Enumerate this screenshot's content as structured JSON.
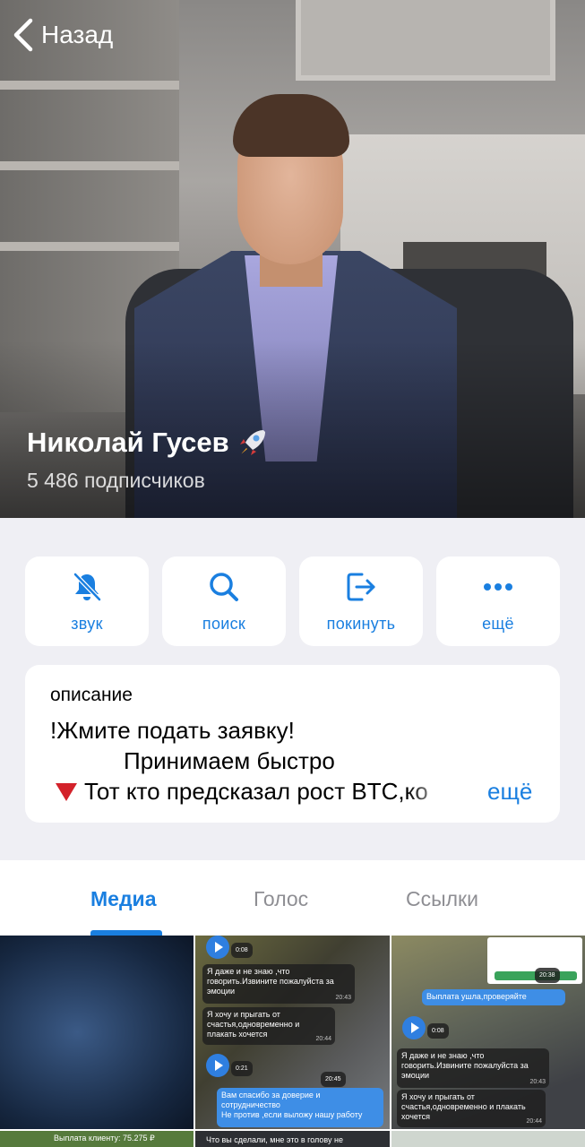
{
  "header": {
    "back_label": "Назад",
    "channel_name": "Николай Гусев",
    "subscribers": "5 486 подписчиков"
  },
  "actions": [
    {
      "label": "звук",
      "icon": "bell-slash-icon"
    },
    {
      "label": "поиск",
      "icon": "search-icon"
    },
    {
      "label": "покинуть",
      "icon": "leave-icon"
    },
    {
      "label": "ещё",
      "icon": "more-dots-icon"
    }
  ],
  "description": {
    "label": "описание",
    "line1": "!Жмите подать заявку!",
    "line2": "Принимаем быстро",
    "line3": "Тот кто предсказал рост BTC,ко",
    "more": "ещё"
  },
  "tabs": [
    {
      "label": "Медиа",
      "active": true
    },
    {
      "label": "Голос",
      "active": false
    },
    {
      "label": "Ссылки",
      "active": false
    }
  ],
  "media": {
    "chat1": {
      "m1": "Я даже и не знаю ,что говорить.Извините пожалуйста за эмоции",
      "m2": "Я хочу и прыгать от счастья,одновременно и плакать хочется",
      "m3": "Вам спасибо за доверие и сотрудничество",
      "m4": "Не против ,если выложу нашу работу",
      "t1": "20:43",
      "t2": "20:44",
      "t3": "20:45",
      "v1": "0:08",
      "v2": "0:21"
    },
    "chat2": {
      "paid": "Выплата ушла,проверяйте",
      "m1": "Я даже и не знаю ,что говорить.Извините пожалуйста за эмоции",
      "m2": "Я хочу и прыгать от счастья,одновременно и плакать хочется",
      "v1": "0:08",
      "t1": "20:43",
      "t2": "20:44",
      "t3": "20:38"
    },
    "bottom": {
      "payout": "Выплата клиенту: 75.275 ₽",
      "partial": "Что вы сделали, мне это в голову не"
    }
  },
  "colors": {
    "accent": "#1a7fe0",
    "background": "#efeff4",
    "card": "#ffffff",
    "red_marker": "#d3222a"
  }
}
